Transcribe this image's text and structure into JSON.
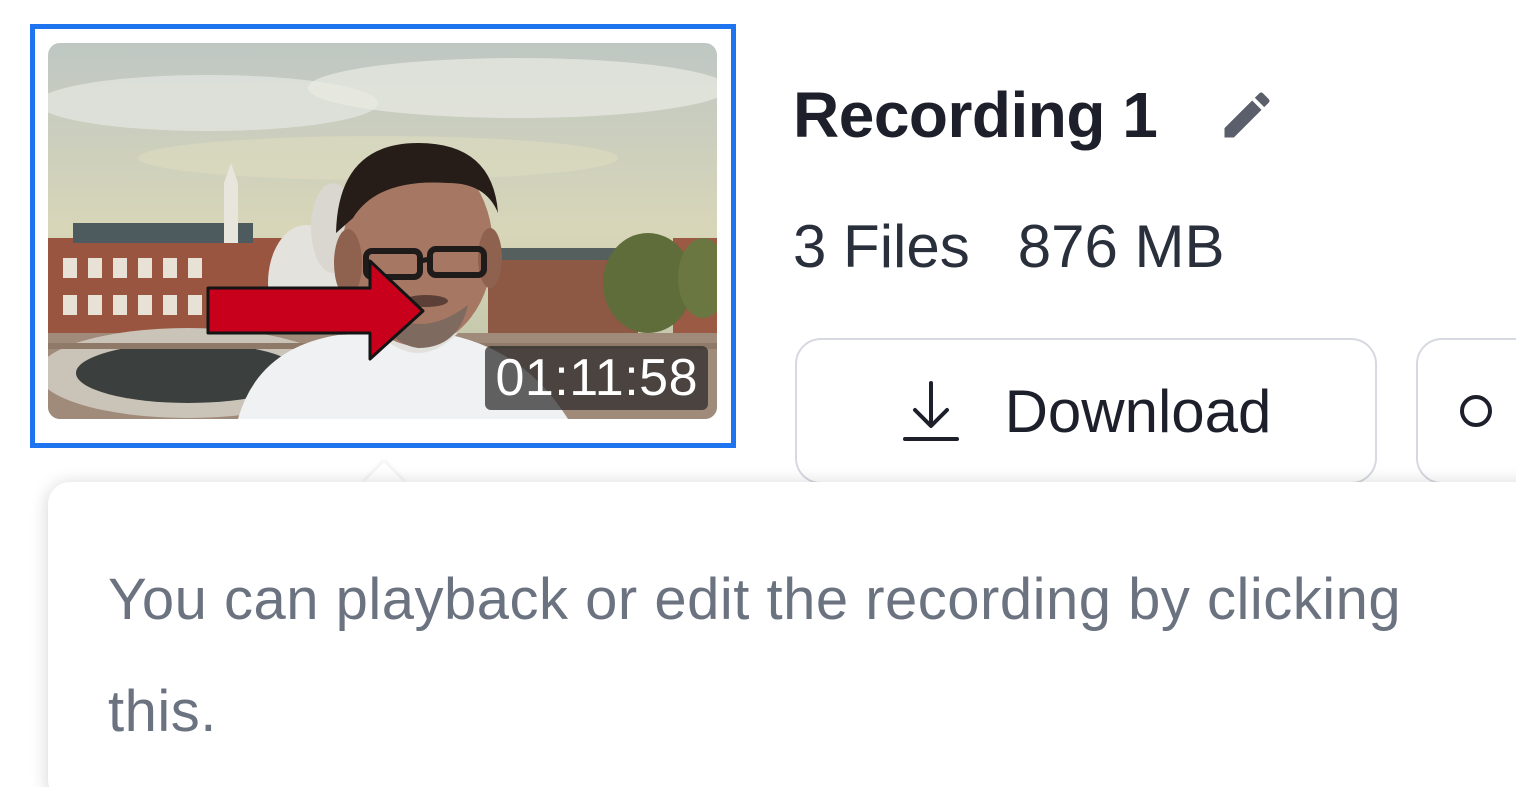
{
  "recording": {
    "title": "Recording 1",
    "files": "3 Files",
    "size": "876 MB",
    "duration": "01:11:58"
  },
  "actions": {
    "download_label": "Download"
  },
  "tooltip": {
    "text": "You can playback or edit the recording by clicking this."
  },
  "icons": {
    "edit": "pencil-icon",
    "download": "download-icon",
    "more": "more-icon",
    "annotation": "red-arrow-icon"
  },
  "colors": {
    "selection_border": "#1f74f0",
    "annotation_arrow": "#c8001b",
    "tooltip_text": "#6b7280"
  }
}
